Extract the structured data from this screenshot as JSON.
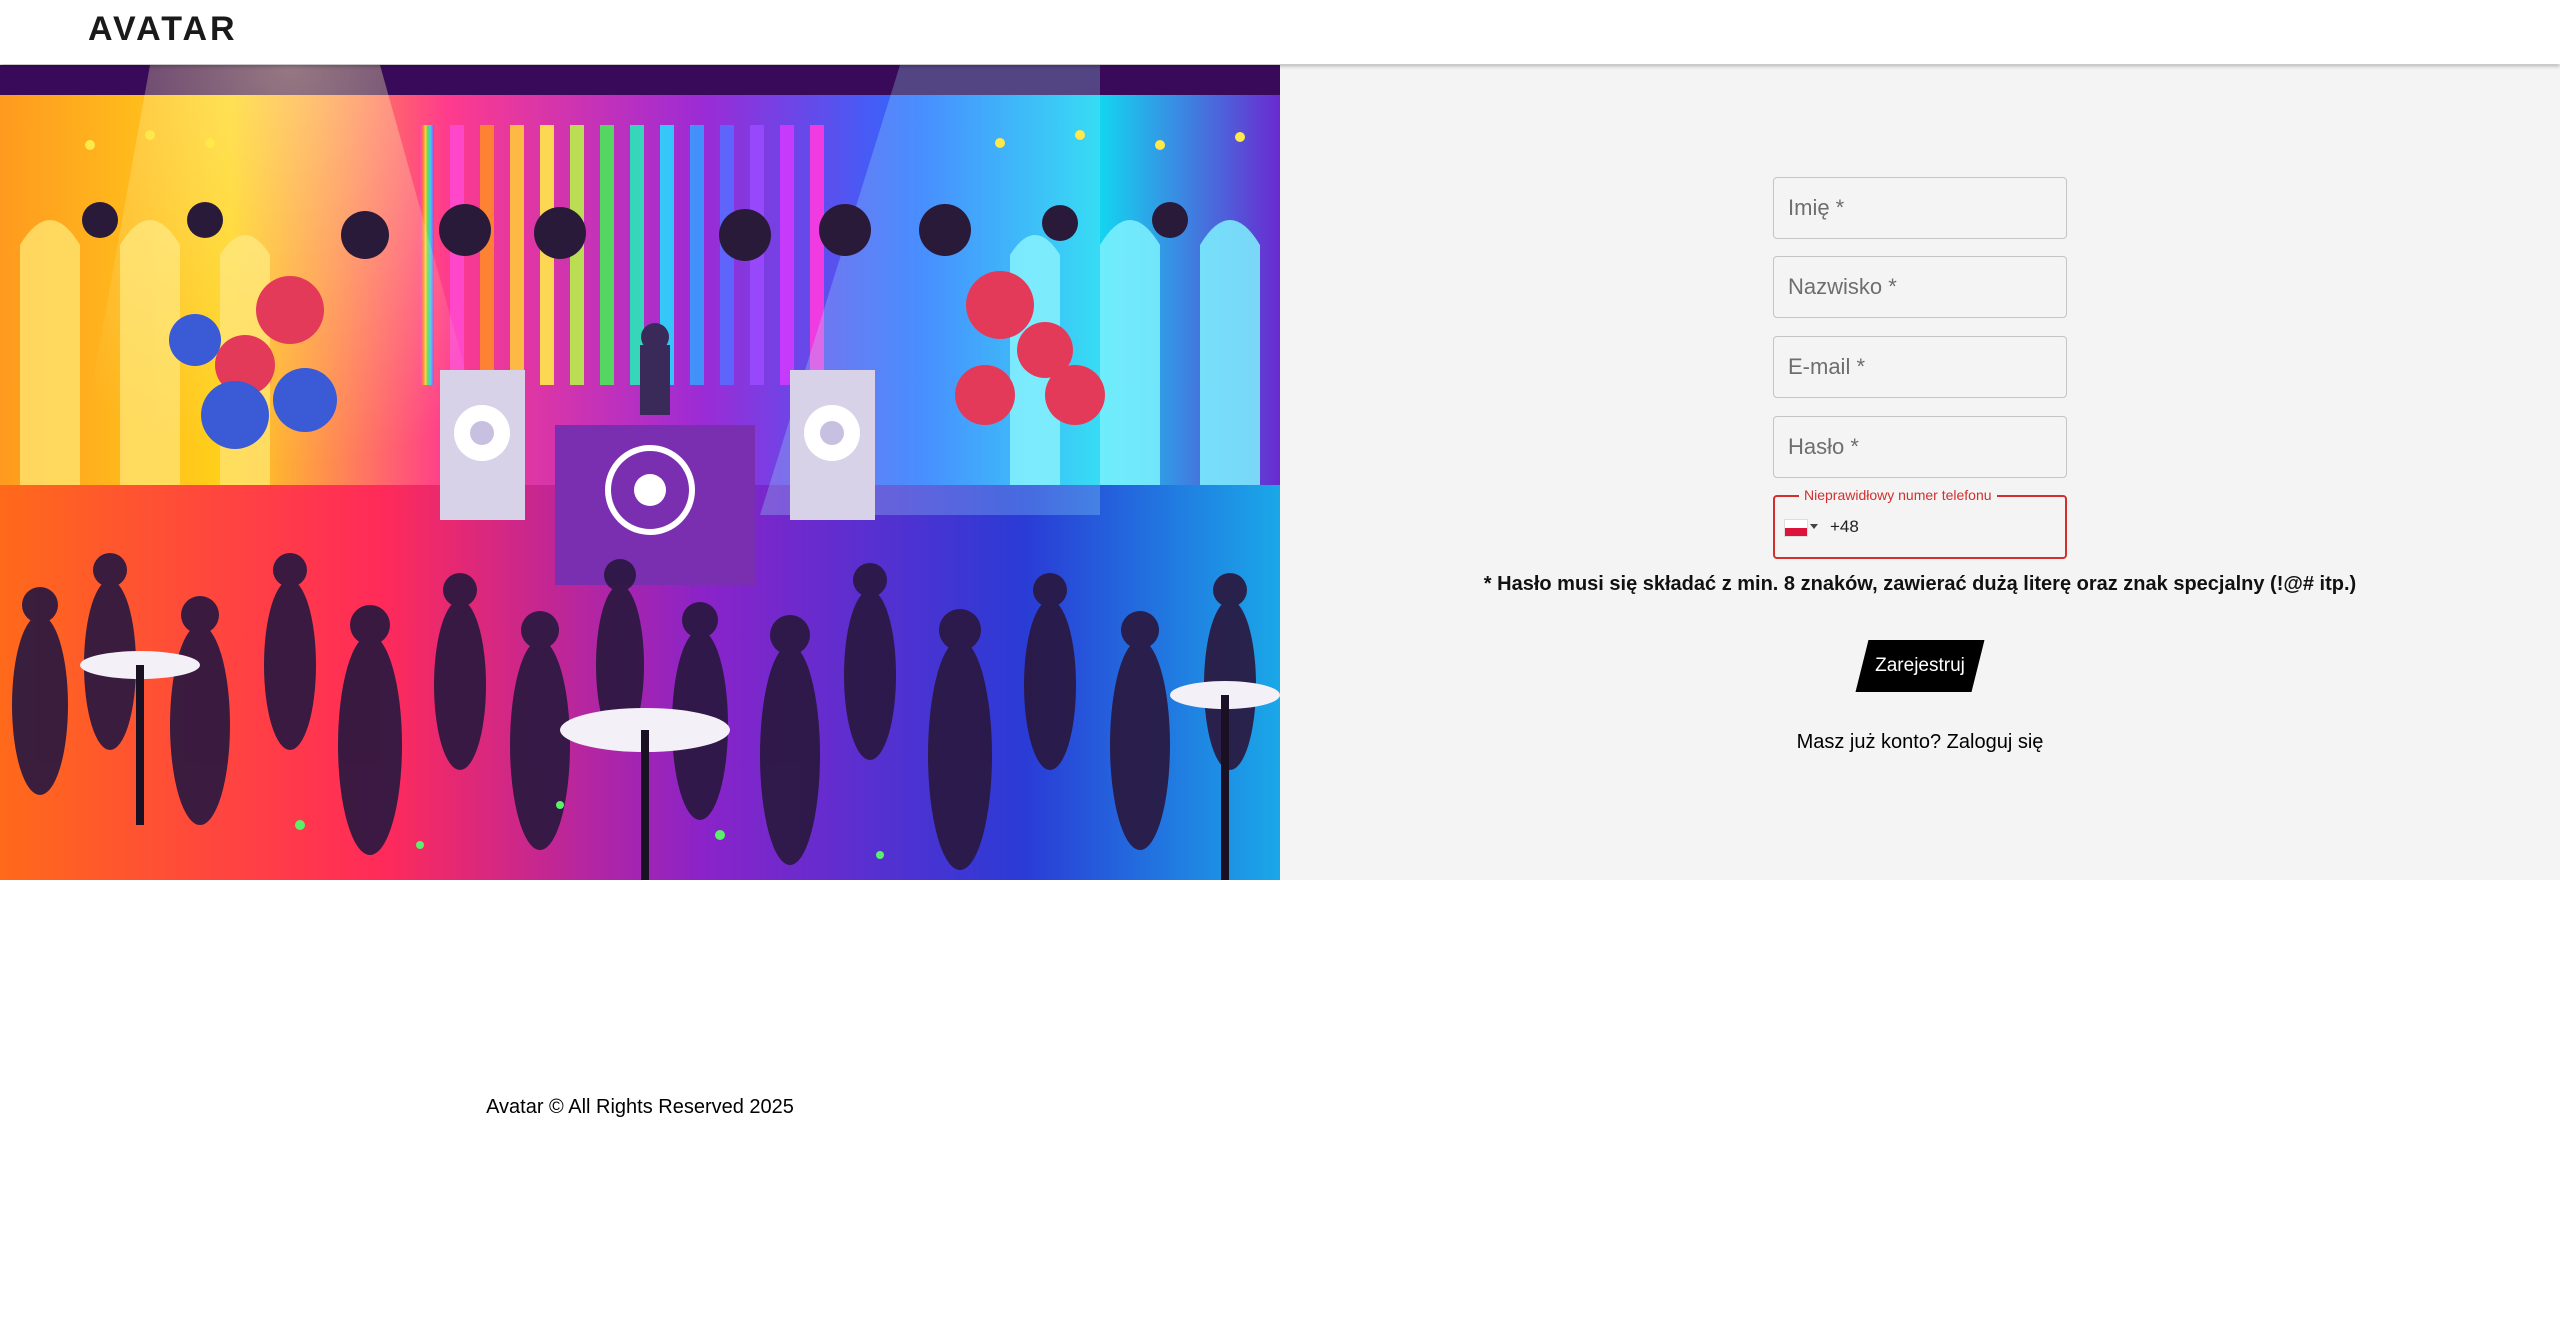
{
  "header": {
    "logo": "AVATAR"
  },
  "hero": {
    "image_description_icon": "party-scene-image"
  },
  "form": {
    "first_name": {
      "placeholder": "Imię *"
    },
    "last_name": {
      "placeholder": "Nazwisko *"
    },
    "email": {
      "placeholder": "E-mail *"
    },
    "password": {
      "placeholder": "Hasło *"
    },
    "phone": {
      "error_label": "Nieprawidłowy numer telefonu",
      "country_flag_icon": "poland-flag-icon",
      "value": "+48"
    },
    "password_hint": "* Hasło musi się składać z min. 8 znaków, zawierać dużą literę oraz znak specjalny (!@# itp.)",
    "register_label": "Zarejestruj",
    "login_prompt": "Masz już konto?",
    "login_link": "Zaloguj się"
  },
  "footer": {
    "text": "Avatar © All Rights Reserved 2025"
  },
  "colors": {
    "panel_bg": "#f4f4f4",
    "error": "#d32f2f",
    "button_bg": "#000000"
  }
}
